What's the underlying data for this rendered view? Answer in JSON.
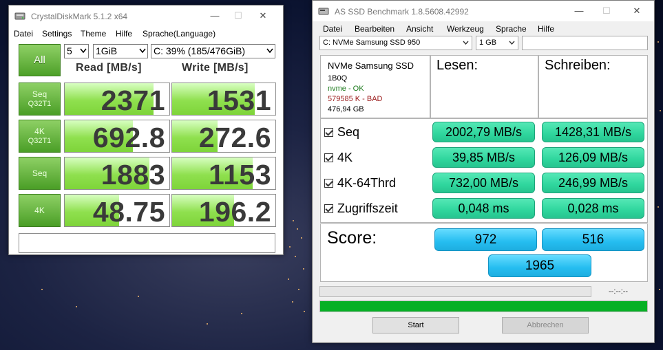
{
  "crystaldiskmark": {
    "title": "CrystalDiskMark 5.1.2 x64",
    "menu": [
      "Datei",
      "Settings",
      "Theme",
      "Hilfe",
      "Sprache(Language)"
    ],
    "all_button": "All",
    "count": "5",
    "size": "1GiB",
    "drive": "C: 39% (185/476GiB)",
    "read_header": "Read [MB/s]",
    "write_header": "Write [MB/s]",
    "rows": [
      {
        "label": "Seq",
        "sub": "Q32T1",
        "read": "2371",
        "write": "1531",
        "read_fill": 0.85,
        "write_fill": 0.8
      },
      {
        "label": "4K",
        "sub": "Q32T1",
        "read": "692.8",
        "write": "272.6",
        "read_fill": 0.65,
        "write_fill": 0.44
      },
      {
        "label": "Seq",
        "sub": "",
        "read": "1883",
        "write": "1153",
        "read_fill": 0.81,
        "write_fill": 0.78
      },
      {
        "label": "4K",
        "sub": "",
        "read": "48.75",
        "write": "196.2",
        "read_fill": 0.52,
        "write_fill": 0.6
      }
    ],
    "comment": ""
  },
  "asssd": {
    "title": "AS SSD Benchmark 1.8.5608.42992",
    "menu": [
      "Datei",
      "Bearbeiten",
      "Ansicht",
      "Werkzeug",
      "Sprache",
      "Hilfe"
    ],
    "drive_select": "C: NVMe Samsung SSD 950",
    "size_select": "1 GB",
    "search_value": "",
    "drive_info": {
      "model": "NVMe Samsung SSD",
      "firmware": "1B0Q",
      "driver": "nvme - OK",
      "alignment": "579585 K - BAD",
      "capacity": "476,94 GB"
    },
    "read_header": "Lesen:",
    "write_header": "Schreiben:",
    "tests": [
      {
        "name": "Seq",
        "read": "2002,79 MB/s",
        "write": "1428,31 MB/s"
      },
      {
        "name": "4K",
        "read": "39,85 MB/s",
        "write": "126,09 MB/s"
      },
      {
        "name": "4K-64Thrd",
        "read": "732,00 MB/s",
        "write": "246,99 MB/s"
      },
      {
        "name": "Zugriffszeit",
        "read": "0,048 ms",
        "write": "0,028 ms"
      }
    ],
    "score_label": "Score:",
    "score_read": "972",
    "score_write": "516",
    "score_total": "1965",
    "timer": "--:--:--",
    "progress_top": 0,
    "progress_bottom": 1.0,
    "start_button": "Start",
    "cancel_button": "Abbrechen",
    "colors": {
      "ok": "#1e7b1e",
      "bad": "#9b1c1c",
      "result_green": "#2fd69d",
      "score_blue": "#25bdf0",
      "progress_green": "#06b025"
    }
  }
}
